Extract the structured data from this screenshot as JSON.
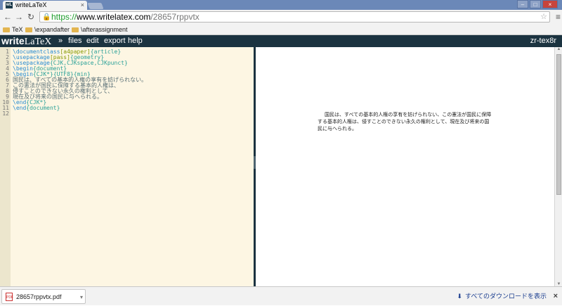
{
  "browser": {
    "tab_title": "writeLaTeX",
    "favicon_label": "wL",
    "url_scheme": "https://",
    "url_host": "www.writelatex.com",
    "url_path": "/28657rppvtx",
    "bookmarks": [
      "TeX",
      "\\expandafter",
      "\\afterassignment"
    ],
    "icons": {
      "back": "back-arrow-icon",
      "forward": "forward-arrow-icon",
      "reload": "reload-icon",
      "lock": "lock-icon",
      "star": "star-icon",
      "menu": "hamburger-menu-icon"
    }
  },
  "app": {
    "logo_write": "write",
    "logo_latex": "LaTeX",
    "chevron": "»",
    "menu": [
      "files",
      "edit",
      "export",
      "help"
    ],
    "project_name": "zr-tex8r",
    "colors": {
      "header_bg": "#1b3340",
      "editor_bg": "#fdf6e3",
      "gutter_bg": "#ece6cd"
    }
  },
  "editor": {
    "line_numbers": [
      "1",
      "2",
      "3",
      "4",
      "5",
      "6",
      "7",
      "8",
      "9",
      "10",
      "11",
      "12"
    ],
    "lines": [
      [
        {
          "t": "\\documentclass",
          "c": "cmd"
        },
        {
          "t": "[a4paper]",
          "c": "opt"
        },
        {
          "t": "{article}",
          "c": "arg"
        }
      ],
      [
        {
          "t": "\\usepackage",
          "c": "cmd"
        },
        {
          "t": "[pass]",
          "c": "opt"
        },
        {
          "t": "{geometry}",
          "c": "arg"
        }
      ],
      [
        {
          "t": "\\usepackage",
          "c": "cmd"
        },
        {
          "t": "{CJK,CJKspace,CJKpunct}",
          "c": "arg"
        }
      ],
      [
        {
          "t": "\\begin",
          "c": "cmd"
        },
        {
          "t": "{document}",
          "c": "arg"
        }
      ],
      [
        {
          "t": "\\begin",
          "c": "cmd"
        },
        {
          "t": "{CJK*}",
          "c": "arg"
        },
        {
          "t": "{UTF8}",
          "c": "arg"
        },
        {
          "t": "{min}",
          "c": "arg"
        }
      ],
      [
        {
          "t": "国民は、すべての基本的人権の享有を妨げられない。",
          "c": "text"
        }
      ],
      [
        {
          "t": "この憲法が国民に保障する基本的人権は、",
          "c": "text"
        }
      ],
      [
        {
          "t": "侵すことのできない永久の権利として、",
          "c": "text"
        }
      ],
      [
        {
          "t": "現在及び将来の国民に与へられる。",
          "c": "text"
        }
      ],
      [
        {
          "t": "\\end",
          "c": "cmd"
        },
        {
          "t": "{CJK*}",
          "c": "arg"
        }
      ],
      [
        {
          "t": "\\end",
          "c": "cmd"
        },
        {
          "t": "{document}",
          "c": "arg"
        }
      ],
      [
        {
          "t": "",
          "c": "text"
        }
      ]
    ]
  },
  "preview": {
    "paragraph": "国民は、すべての基本的人権の享有を妨げられない、この憲法が国民に保障する基本的人権は、侵すことのできない永久の権利として、現在及び将来の国民に与へられる。"
  },
  "downloads": {
    "file_name": "28657rppvtx.pdf",
    "file_type_label": "PDF",
    "show_all": "すべてのダウンロードを表示",
    "close": "×"
  }
}
